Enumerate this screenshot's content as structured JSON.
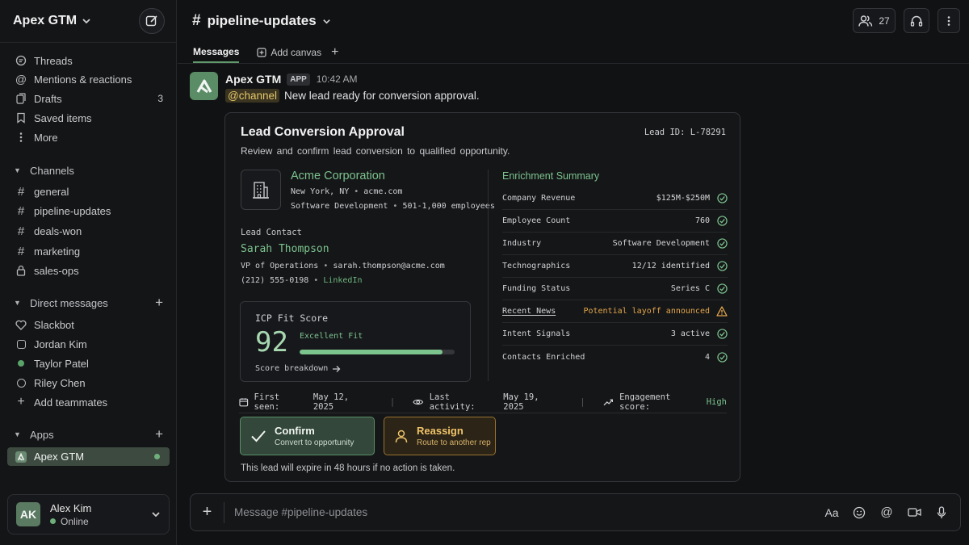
{
  "workspace": {
    "name": "Apex GTM"
  },
  "sidebar": {
    "nav": [
      {
        "label": "Threads",
        "icon": "threads-icon"
      },
      {
        "label": "Mentions & reactions",
        "icon": "at-icon"
      },
      {
        "label": "Drafts",
        "icon": "drafts-icon",
        "badge": "3"
      },
      {
        "label": "Saved items",
        "icon": "bookmark-icon"
      },
      {
        "label": "More",
        "icon": "more-vertical-icon"
      }
    ],
    "channels_title": "Channels",
    "channels": [
      "general",
      "pipeline-updates",
      "deals-won",
      "marketing",
      "sales-ops"
    ],
    "dm_title": "Direct messages",
    "dms": [
      {
        "name": "Slackbot",
        "presence": "bot"
      },
      {
        "name": "Jordan Kim",
        "presence": "away"
      },
      {
        "name": "Taylor Patel",
        "presence": "online"
      },
      {
        "name": "Riley Chen",
        "presence": "away"
      }
    ],
    "add_teammates": "Add teammates",
    "apps_title": "Apps",
    "apps": [
      {
        "name": "Apex GTM",
        "active": true
      }
    ]
  },
  "user": {
    "initials": "AK",
    "name": "Alex Kim",
    "status": "Online"
  },
  "channel": {
    "hash": "#",
    "name": "pipeline-updates",
    "members": "27",
    "tabs": {
      "messages": "Messages",
      "add_canvas": "Add canvas"
    }
  },
  "message": {
    "sender": "Apex GTM",
    "tag": "APP",
    "time": "10:42 AM",
    "mention": "@channel",
    "text": "New lead ready for conversion approval."
  },
  "card": {
    "title": "Lead Conversion Approval",
    "subtitle": "Review and confirm lead conversion to qualified opportunity.",
    "lead_id": "Lead ID: L-78291",
    "company": {
      "name": "Acme Corporation",
      "location": "New York, NY",
      "domain": "acme.com",
      "industry": "Software Development",
      "size": "501-1,000 employees"
    },
    "contact": {
      "label": "Lead Contact",
      "name": "Sarah Thompson",
      "title": "VP of Operations",
      "email": "sarah.thompson@acme.com",
      "phone": "(212) 555-0198",
      "linkedin": "LinkedIn"
    },
    "icp": {
      "label": "ICP Fit Score",
      "score": "92",
      "fit": "Excellent Fit",
      "percent": 92,
      "breakdown": "Score breakdown"
    },
    "enrichment": {
      "title": "Enrichment Summary",
      "rows": [
        {
          "label": "Company Revenue",
          "value": "$125M-$250M",
          "status": "ok"
        },
        {
          "label": "Employee Count",
          "value": "760",
          "status": "ok"
        },
        {
          "label": "Industry",
          "value": "Software Development",
          "status": "ok"
        },
        {
          "label": "Technographics",
          "value": "12/12 identified",
          "status": "ok"
        },
        {
          "label": "Funding Status",
          "value": "Series C",
          "status": "ok"
        },
        {
          "label": "Recent News",
          "value": "Potential layoff announced",
          "status": "warn"
        },
        {
          "label": "Intent Signals",
          "value": "3 active",
          "status": "ok"
        },
        {
          "label": "Contacts Enriched",
          "value": "4",
          "status": "ok"
        }
      ]
    },
    "meta": {
      "first_seen_label": "First seen:",
      "first_seen": "May 12, 2025",
      "last_activity_label": "Last activity:",
      "last_activity": "May 19, 2025",
      "engagement_label": "Engagement score:",
      "engagement": "High"
    },
    "actions": {
      "confirm_title": "Confirm",
      "confirm_sub": "Convert to opportunity",
      "reassign_title": "Reassign",
      "reassign_sub": "Route to another rep"
    },
    "expire": "This lead will expire in 48 hours if no action is taken."
  },
  "composer": {
    "placeholder": "Message #pipeline-updates",
    "format_label": "Aa"
  },
  "colors": {
    "accent_green": "#7cc38e",
    "warning": "#e3a64a",
    "background": "#111214"
  }
}
